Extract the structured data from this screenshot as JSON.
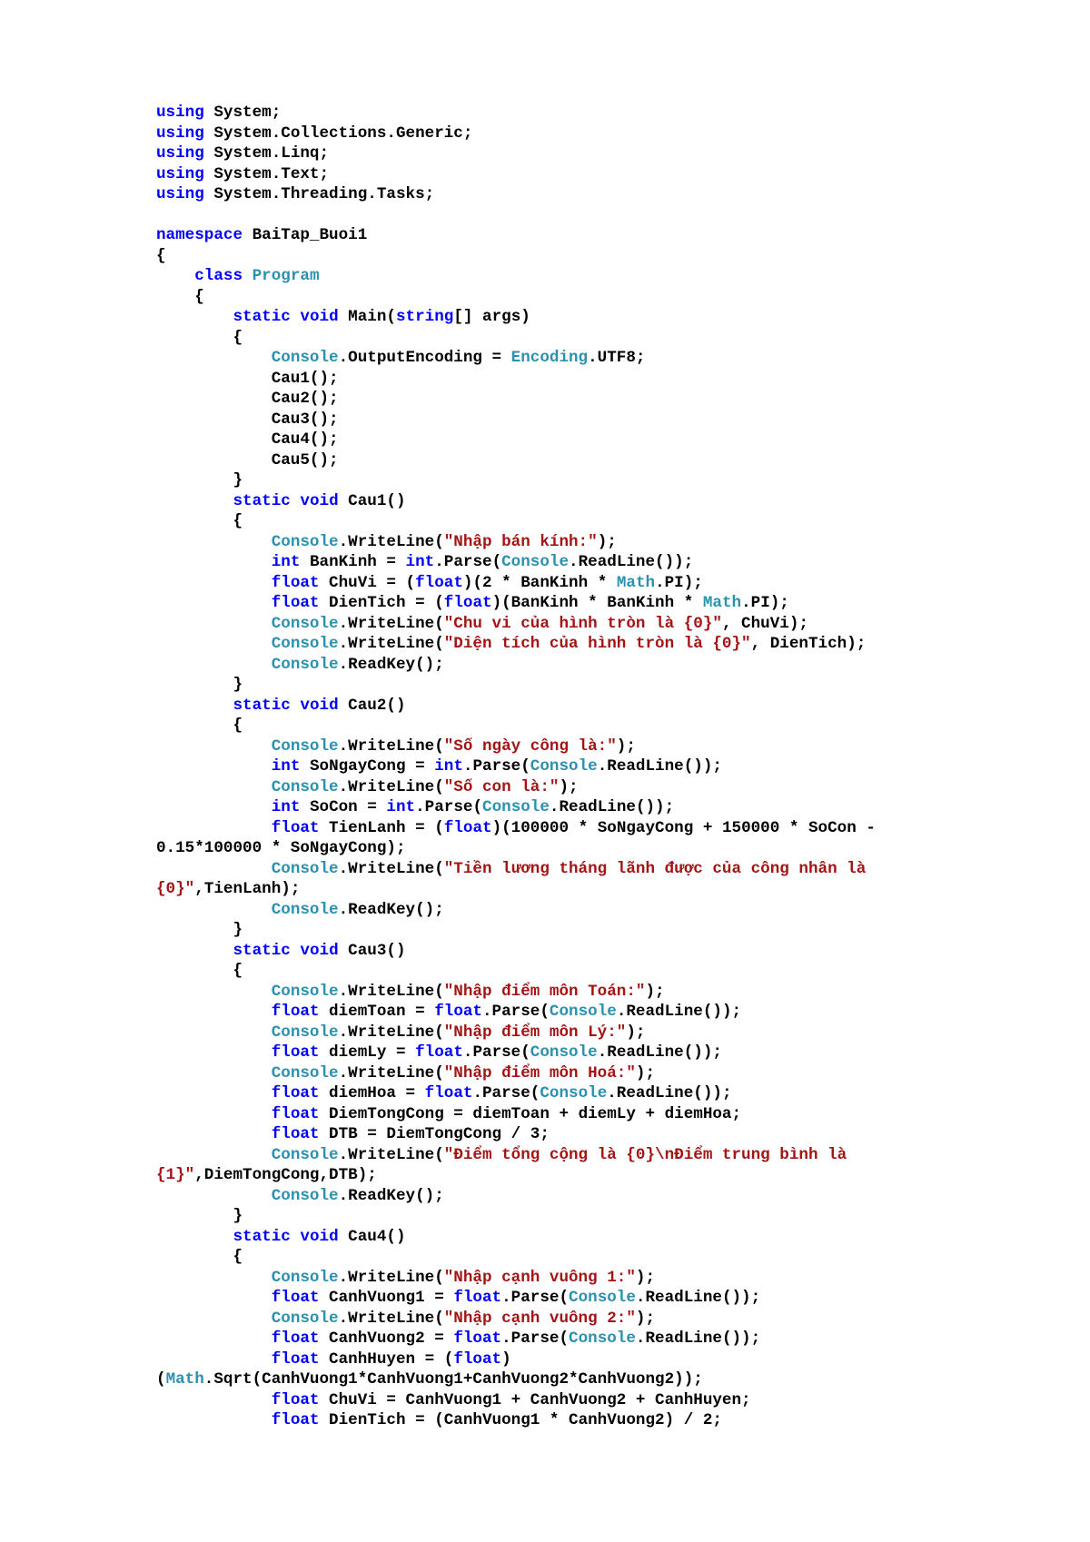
{
  "colors": {
    "keyword": "#0000FF",
    "type": "#2B91AF",
    "string": "#A31515",
    "plain": "#000000"
  },
  "lines": [
    [
      [
        "k",
        "using"
      ],
      [
        "p",
        " System;"
      ]
    ],
    [
      [
        "k",
        "using"
      ],
      [
        "p",
        " System.Collections.Generic;"
      ]
    ],
    [
      [
        "k",
        "using"
      ],
      [
        "p",
        " System.Linq;"
      ]
    ],
    [
      [
        "k",
        "using"
      ],
      [
        "p",
        " System.Text;"
      ]
    ],
    [
      [
        "k",
        "using"
      ],
      [
        "p",
        " System.Threading.Tasks;"
      ]
    ],
    [],
    [
      [
        "k",
        "namespace"
      ],
      [
        "p",
        " BaiTap_Buoi1"
      ]
    ],
    [
      [
        "p",
        "{"
      ]
    ],
    [
      [
        "p",
        "    "
      ],
      [
        "k",
        "class"
      ],
      [
        "p",
        " "
      ],
      [
        "t",
        "Program"
      ]
    ],
    [
      [
        "p",
        "    {"
      ]
    ],
    [
      [
        "p",
        "        "
      ],
      [
        "k",
        "static"
      ],
      [
        "p",
        " "
      ],
      [
        "k",
        "void"
      ],
      [
        "p",
        " Main("
      ],
      [
        "k",
        "string"
      ],
      [
        "p",
        "[] args)"
      ]
    ],
    [
      [
        "p",
        "        {"
      ]
    ],
    [
      [
        "p",
        "            "
      ],
      [
        "t",
        "Console"
      ],
      [
        "p",
        ".OutputEncoding = "
      ],
      [
        "t",
        "Encoding"
      ],
      [
        "p",
        ".UTF8;"
      ]
    ],
    [
      [
        "p",
        "            Cau1();"
      ]
    ],
    [
      [
        "p",
        "            Cau2();"
      ]
    ],
    [
      [
        "p",
        "            Cau3();"
      ]
    ],
    [
      [
        "p",
        "            Cau4();"
      ]
    ],
    [
      [
        "p",
        "            Cau5();"
      ]
    ],
    [
      [
        "p",
        "        }"
      ]
    ],
    [
      [
        "p",
        "        "
      ],
      [
        "k",
        "static"
      ],
      [
        "p",
        " "
      ],
      [
        "k",
        "void"
      ],
      [
        "p",
        " Cau1()"
      ]
    ],
    [
      [
        "p",
        "        {"
      ]
    ],
    [
      [
        "p",
        "            "
      ],
      [
        "t",
        "Console"
      ],
      [
        "p",
        ".WriteLine("
      ],
      [
        "s",
        "\"Nhập bán kính:\""
      ],
      [
        "p",
        ");"
      ]
    ],
    [
      [
        "p",
        "            "
      ],
      [
        "k",
        "int"
      ],
      [
        "p",
        " BanKinh = "
      ],
      [
        "k",
        "int"
      ],
      [
        "p",
        ".Parse("
      ],
      [
        "t",
        "Console"
      ],
      [
        "p",
        ".ReadLine());"
      ]
    ],
    [
      [
        "p",
        "            "
      ],
      [
        "k",
        "float"
      ],
      [
        "p",
        " ChuVi = ("
      ],
      [
        "k",
        "float"
      ],
      [
        "p",
        ")(2 * BanKinh * "
      ],
      [
        "t",
        "Math"
      ],
      [
        "p",
        ".PI);"
      ]
    ],
    [
      [
        "p",
        "            "
      ],
      [
        "k",
        "float"
      ],
      [
        "p",
        " DienTich = ("
      ],
      [
        "k",
        "float"
      ],
      [
        "p",
        ")(BanKinh * BanKinh * "
      ],
      [
        "t",
        "Math"
      ],
      [
        "p",
        ".PI);"
      ]
    ],
    [
      [
        "p",
        "            "
      ],
      [
        "t",
        "Console"
      ],
      [
        "p",
        ".WriteLine("
      ],
      [
        "s",
        "\"Chu vi của hình tròn là {0}\""
      ],
      [
        "p",
        ", ChuVi);"
      ]
    ],
    [
      [
        "p",
        "            "
      ],
      [
        "t",
        "Console"
      ],
      [
        "p",
        ".WriteLine("
      ],
      [
        "s",
        "\"Diện tích của hình tròn là {0}\""
      ],
      [
        "p",
        ", DienTich);"
      ]
    ],
    [
      [
        "p",
        "            "
      ],
      [
        "t",
        "Console"
      ],
      [
        "p",
        ".ReadKey();"
      ]
    ],
    [
      [
        "p",
        "        }"
      ]
    ],
    [
      [
        "p",
        "        "
      ],
      [
        "k",
        "static"
      ],
      [
        "p",
        " "
      ],
      [
        "k",
        "void"
      ],
      [
        "p",
        " Cau2()"
      ]
    ],
    [
      [
        "p",
        "        {"
      ]
    ],
    [
      [
        "p",
        "            "
      ],
      [
        "t",
        "Console"
      ],
      [
        "p",
        ".WriteLine("
      ],
      [
        "s",
        "\"Số ngày công là:\""
      ],
      [
        "p",
        ");"
      ]
    ],
    [
      [
        "p",
        "            "
      ],
      [
        "k",
        "int"
      ],
      [
        "p",
        " SoNgayCong = "
      ],
      [
        "k",
        "int"
      ],
      [
        "p",
        ".Parse("
      ],
      [
        "t",
        "Console"
      ],
      [
        "p",
        ".ReadLine());"
      ]
    ],
    [
      [
        "p",
        "            "
      ],
      [
        "t",
        "Console"
      ],
      [
        "p",
        ".WriteLine("
      ],
      [
        "s",
        "\"Số con là:\""
      ],
      [
        "p",
        ");"
      ]
    ],
    [
      [
        "p",
        "            "
      ],
      [
        "k",
        "int"
      ],
      [
        "p",
        " SoCon = "
      ],
      [
        "k",
        "int"
      ],
      [
        "p",
        ".Parse("
      ],
      [
        "t",
        "Console"
      ],
      [
        "p",
        ".ReadLine());"
      ]
    ],
    [
      [
        "p",
        "            "
      ],
      [
        "k",
        "float"
      ],
      [
        "p",
        " TienLanh = ("
      ],
      [
        "k",
        "float"
      ],
      [
        "p",
        ")(100000 * SoNgayCong + 150000 * SoCon -"
      ]
    ],
    [
      [
        "p",
        "0.15*100000 * SoNgayCong);"
      ]
    ],
    [
      [
        "p",
        "            "
      ],
      [
        "t",
        "Console"
      ],
      [
        "p",
        ".WriteLine("
      ],
      [
        "s",
        "\"Tiền lương tháng lãnh được của công nhân là"
      ]
    ],
    [
      [
        "s",
        "{0}\""
      ],
      [
        "p",
        ",TienLanh);"
      ]
    ],
    [
      [
        "p",
        "            "
      ],
      [
        "t",
        "Console"
      ],
      [
        "p",
        ".ReadKey();"
      ]
    ],
    [
      [
        "p",
        "        }"
      ]
    ],
    [
      [
        "p",
        "        "
      ],
      [
        "k",
        "static"
      ],
      [
        "p",
        " "
      ],
      [
        "k",
        "void"
      ],
      [
        "p",
        " Cau3()"
      ]
    ],
    [
      [
        "p",
        "        {"
      ]
    ],
    [
      [
        "p",
        "            "
      ],
      [
        "t",
        "Console"
      ],
      [
        "p",
        ".WriteLine("
      ],
      [
        "s",
        "\"Nhập điểm môn Toán:\""
      ],
      [
        "p",
        ");"
      ]
    ],
    [
      [
        "p",
        "            "
      ],
      [
        "k",
        "float"
      ],
      [
        "p",
        " diemToan = "
      ],
      [
        "k",
        "float"
      ],
      [
        "p",
        ".Parse("
      ],
      [
        "t",
        "Console"
      ],
      [
        "p",
        ".ReadLine());"
      ]
    ],
    [
      [
        "p",
        "            "
      ],
      [
        "t",
        "Console"
      ],
      [
        "p",
        ".WriteLine("
      ],
      [
        "s",
        "\"Nhập điểm môn Lý:\""
      ],
      [
        "p",
        ");"
      ]
    ],
    [
      [
        "p",
        "            "
      ],
      [
        "k",
        "float"
      ],
      [
        "p",
        " diemLy = "
      ],
      [
        "k",
        "float"
      ],
      [
        "p",
        ".Parse("
      ],
      [
        "t",
        "Console"
      ],
      [
        "p",
        ".ReadLine());"
      ]
    ],
    [
      [
        "p",
        "            "
      ],
      [
        "t",
        "Console"
      ],
      [
        "p",
        ".WriteLine("
      ],
      [
        "s",
        "\"Nhập điểm môn Hoá:\""
      ],
      [
        "p",
        ");"
      ]
    ],
    [
      [
        "p",
        "            "
      ],
      [
        "k",
        "float"
      ],
      [
        "p",
        " diemHoa = "
      ],
      [
        "k",
        "float"
      ],
      [
        "p",
        ".Parse("
      ],
      [
        "t",
        "Console"
      ],
      [
        "p",
        ".ReadLine());"
      ]
    ],
    [
      [
        "p",
        "            "
      ],
      [
        "k",
        "float"
      ],
      [
        "p",
        " DiemTongCong = diemToan + diemLy + diemHoa;"
      ]
    ],
    [
      [
        "p",
        "            "
      ],
      [
        "k",
        "float"
      ],
      [
        "p",
        " DTB = DiemTongCong / 3;"
      ]
    ],
    [
      [
        "p",
        "            "
      ],
      [
        "t",
        "Console"
      ],
      [
        "p",
        ".WriteLine("
      ],
      [
        "s",
        "\"Điểm tổng cộng là {0}\\nĐiểm trung bình là"
      ]
    ],
    [
      [
        "s",
        "{1}\""
      ],
      [
        "p",
        ",DiemTongCong,DTB);"
      ]
    ],
    [
      [
        "p",
        "            "
      ],
      [
        "t",
        "Console"
      ],
      [
        "p",
        ".ReadKey();"
      ]
    ],
    [
      [
        "p",
        "        }"
      ]
    ],
    [
      [
        "p",
        "        "
      ],
      [
        "k",
        "static"
      ],
      [
        "p",
        " "
      ],
      [
        "k",
        "void"
      ],
      [
        "p",
        " Cau4()"
      ]
    ],
    [
      [
        "p",
        "        {"
      ]
    ],
    [
      [
        "p",
        "            "
      ],
      [
        "t",
        "Console"
      ],
      [
        "p",
        ".WriteLine("
      ],
      [
        "s",
        "\"Nhập cạnh vuông 1:\""
      ],
      [
        "p",
        ");"
      ]
    ],
    [
      [
        "p",
        "            "
      ],
      [
        "k",
        "float"
      ],
      [
        "p",
        " CanhVuong1 = "
      ],
      [
        "k",
        "float"
      ],
      [
        "p",
        ".Parse("
      ],
      [
        "t",
        "Console"
      ],
      [
        "p",
        ".ReadLine());"
      ]
    ],
    [
      [
        "p",
        "            "
      ],
      [
        "t",
        "Console"
      ],
      [
        "p",
        ".WriteLine("
      ],
      [
        "s",
        "\"Nhập cạnh vuông 2:\""
      ],
      [
        "p",
        ");"
      ]
    ],
    [
      [
        "p",
        "            "
      ],
      [
        "k",
        "float"
      ],
      [
        "p",
        " CanhVuong2 = "
      ],
      [
        "k",
        "float"
      ],
      [
        "p",
        ".Parse("
      ],
      [
        "t",
        "Console"
      ],
      [
        "p",
        ".ReadLine());"
      ]
    ],
    [
      [
        "p",
        "            "
      ],
      [
        "k",
        "float"
      ],
      [
        "p",
        " CanhHuyen = ("
      ],
      [
        "k",
        "float"
      ],
      [
        "p",
        ")"
      ]
    ],
    [
      [
        "p",
        "("
      ],
      [
        "t",
        "Math"
      ],
      [
        "p",
        ".Sqrt(CanhVuong1*CanhVuong1+CanhVuong2*CanhVuong2));"
      ]
    ],
    [
      [
        "p",
        "            "
      ],
      [
        "k",
        "float"
      ],
      [
        "p",
        " ChuVi = CanhVuong1 + CanhVuong2 + CanhHuyen;"
      ]
    ],
    [
      [
        "p",
        "            "
      ],
      [
        "k",
        "float"
      ],
      [
        "p",
        " DienTich = (CanhVuong1 * CanhVuong2) / 2;"
      ]
    ]
  ]
}
